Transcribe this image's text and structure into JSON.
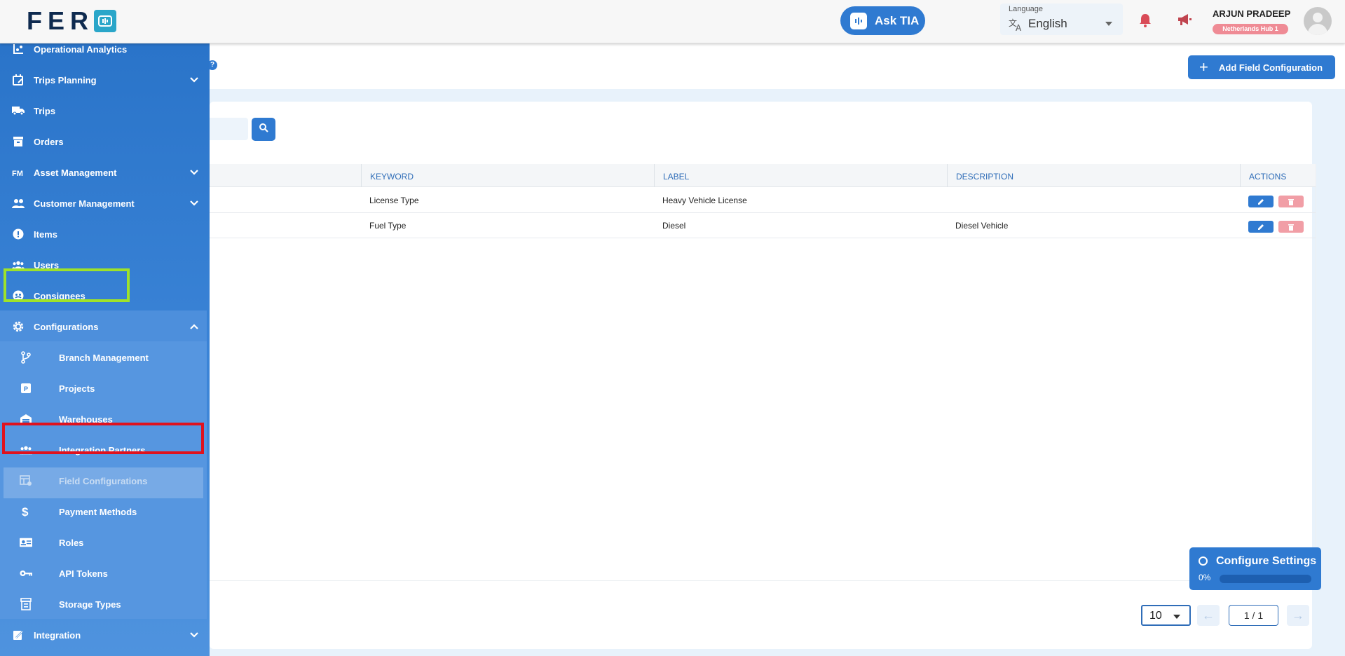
{
  "header": {
    "logo_text": "FER",
    "ask_tia_label": "Ask TIA",
    "language_label": "Language",
    "language_value": "English",
    "user_name": "ARJUN PRADEEP",
    "user_branch": "Netherlands Hub 1"
  },
  "sidebar": {
    "items": [
      {
        "label": "Operational Analytics",
        "icon": "analytics-icon"
      },
      {
        "label": "Trips Planning",
        "icon": "calendar-edit-icon",
        "expandable": true
      },
      {
        "label": "Trips",
        "icon": "truck-icon"
      },
      {
        "label": "Orders",
        "icon": "archive-icon"
      },
      {
        "label": "Asset Management",
        "icon": "fm-icon",
        "expandable": true
      },
      {
        "label": "Customer Management",
        "icon": "people-icon",
        "expandable": true
      },
      {
        "label": "Items",
        "icon": "info-icon"
      },
      {
        "label": "Users",
        "icon": "users-icon"
      },
      {
        "label": "Consignees",
        "icon": "consignee-icon"
      },
      {
        "label": "Configurations",
        "icon": "gear-icon",
        "expanded": true
      }
    ],
    "sub_items": [
      {
        "label": "Branch Management",
        "icon": "branch-icon"
      },
      {
        "label": "Projects",
        "icon": "projects-icon"
      },
      {
        "label": "Warehouses",
        "icon": "warehouse-icon"
      },
      {
        "label": "Integration Partners",
        "icon": "partners-icon"
      },
      {
        "label": "Field Configurations",
        "icon": "field-config-icon",
        "active": true
      },
      {
        "label": "Payment Methods",
        "icon": "dollar-icon"
      },
      {
        "label": "Roles",
        "icon": "id-card-icon"
      },
      {
        "label": "API Tokens",
        "icon": "key-icon"
      },
      {
        "label": "Storage Types",
        "icon": "storage-icon"
      }
    ],
    "footer_item": {
      "label": "Integration",
      "icon": "integration-icon",
      "expandable": true
    }
  },
  "toolbar": {
    "add_button_label": "Add Field Configuration"
  },
  "table": {
    "columns": [
      "KEYWORD",
      "LABEL",
      "DESCRIPTION",
      "ACTIONS"
    ],
    "rows": [
      {
        "keyword": "License Type",
        "label": "Heavy Vehicle License",
        "description": ""
      },
      {
        "keyword": "Fuel Type",
        "label": "Diesel",
        "description": "Diesel Vehicle"
      }
    ]
  },
  "pagination": {
    "page_size": "10",
    "page_indicator": "1 / 1"
  },
  "configure_widget": {
    "title": "Configure Settings",
    "progress_label": "0%",
    "progress": 0
  },
  "colors": {
    "accent": "#2f7ad1",
    "highlight_green": "#9ee22a",
    "highlight_red": "#e0121e",
    "badge": "#ef8b95"
  }
}
